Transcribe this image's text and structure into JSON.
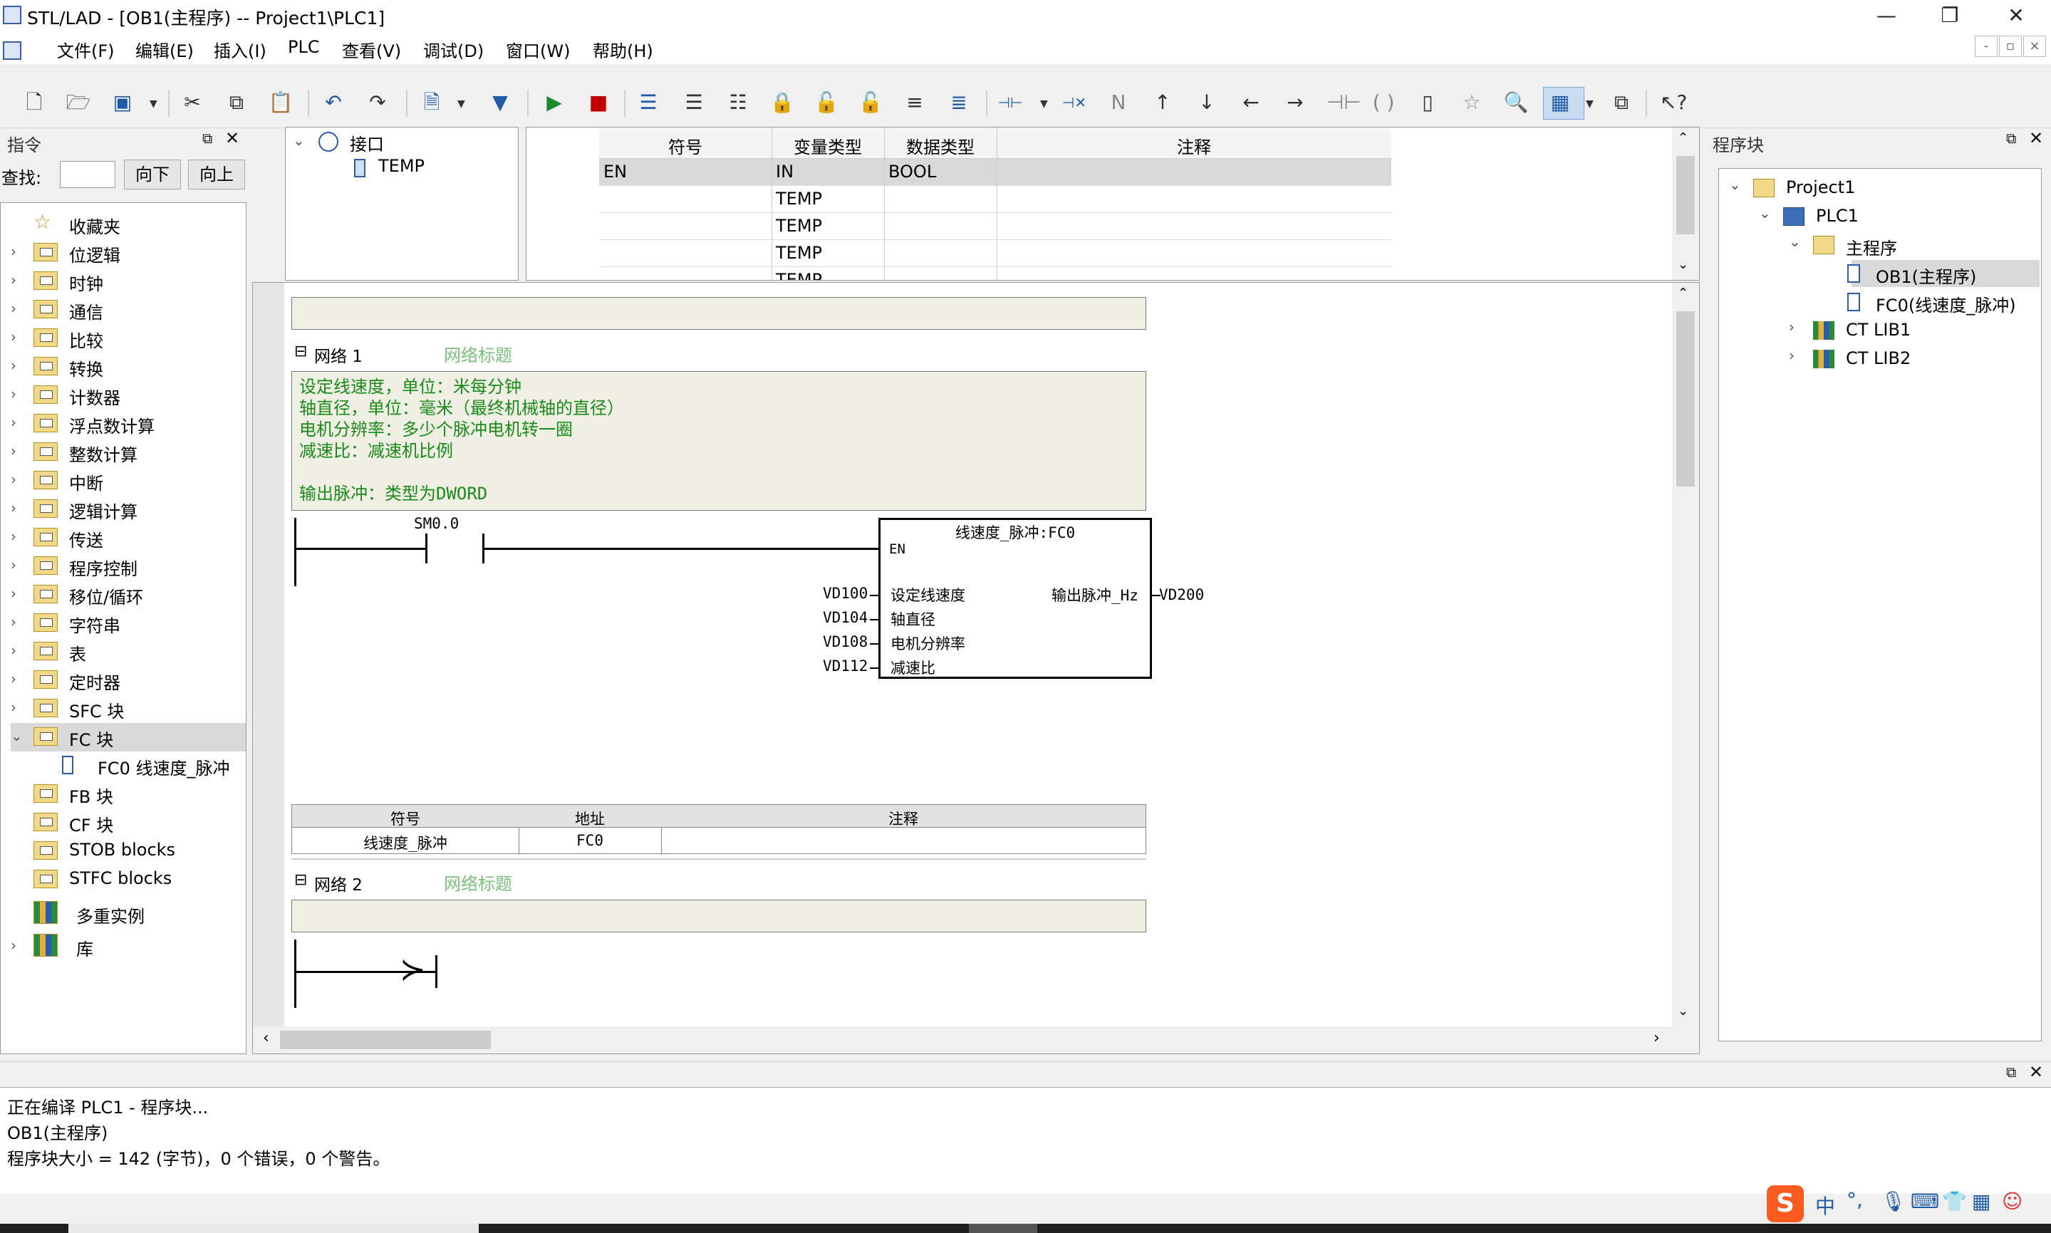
{
  "window": {
    "title": "STL/LAD - [OB1(主程序) -- Project1\\PLC1]",
    "min": "—",
    "restore": "❐",
    "close": "✕"
  },
  "menu": {
    "items": [
      "文件(F)",
      "编辑(E)",
      "插入(I)",
      "PLC",
      "查看(V)",
      "调试(D)",
      "窗口(W)",
      "帮助(H)"
    ]
  },
  "toolbar": {
    "icons": [
      "new-icon",
      "open-icon",
      "save-icon",
      "cut-icon",
      "copy-icon",
      "paste-icon",
      "undo-icon",
      "redo-icon",
      "compile-icon",
      "download-icon",
      "run-icon",
      "stop-icon",
      "insert-network-icon",
      "delete-network-icon",
      "network-icon",
      "lock-icon",
      "unlock-icon",
      "unlock-blue-icon",
      "comment-icon",
      "comment-toggle-icon",
      "contact-insert-icon",
      "contact-delete-icon",
      "negate-icon",
      "line-up-icon",
      "line-down-icon",
      "line-left-icon",
      "line-right-icon",
      "contact-icon",
      "coil-icon",
      "box-icon",
      "favorite-icon",
      "zoom-icon",
      "grid-view-icon",
      "window-icon",
      "help-icon"
    ]
  },
  "instructions": {
    "title": "指令",
    "find_label": "查找:",
    "find_value": "",
    "down_button": "向下",
    "up_button": "向上",
    "items": [
      {
        "label": "收藏夹",
        "expand": ""
      },
      {
        "label": "位逻辑",
        "expand": "›"
      },
      {
        "label": "时钟",
        "expand": "›"
      },
      {
        "label": "通信",
        "expand": "›"
      },
      {
        "label": "比较",
        "expand": "›"
      },
      {
        "label": "转换",
        "expand": "›"
      },
      {
        "label": "计数器",
        "expand": "›"
      },
      {
        "label": "浮点数计算",
        "expand": "›"
      },
      {
        "label": "整数计算",
        "expand": "›"
      },
      {
        "label": "中断",
        "expand": "›"
      },
      {
        "label": "逻辑计算",
        "expand": "›"
      },
      {
        "label": "传送",
        "expand": "›"
      },
      {
        "label": "程序控制",
        "expand": "›"
      },
      {
        "label": "移位/循环",
        "expand": "›"
      },
      {
        "label": "字符串",
        "expand": "›"
      },
      {
        "label": "表",
        "expand": "›"
      },
      {
        "label": "定时器",
        "expand": "›"
      },
      {
        "label": "SFC 块",
        "expand": "›"
      },
      {
        "label": "FC 块",
        "expand": "⌄"
      },
      {
        "label": "FC0  线速度_脉冲",
        "expand": ""
      },
      {
        "label": "FB 块",
        "expand": ""
      },
      {
        "label": "CF 块",
        "expand": ""
      },
      {
        "label": "STOB blocks",
        "expand": ""
      },
      {
        "label": "STFC blocks",
        "expand": ""
      },
      {
        "label": "多重实例",
        "expand": ""
      },
      {
        "label": "库",
        "expand": "›"
      }
    ]
  },
  "interface": {
    "root": "接口",
    "child": "TEMP",
    "headers": [
      "符号",
      "变量类型",
      "数据类型",
      "注释"
    ],
    "rows": [
      [
        "EN",
        "IN",
        "BOOL",
        ""
      ],
      [
        "",
        "TEMP",
        "",
        ""
      ],
      [
        "",
        "TEMP",
        "",
        ""
      ],
      [
        "",
        "TEMP",
        "",
        ""
      ],
      [
        "",
        "TEMP",
        "",
        ""
      ]
    ]
  },
  "editor": {
    "network1": {
      "label": "网络 1",
      "title_placeholder": "网络标题",
      "comment": [
        "设定线速度，单位：米每分钟",
        "轴直径，单位：毫米（最终机械轴的直径）",
        "电机分辨率：多少个脉冲电机转一圈",
        "减速比：减速机比例",
        "",
        "输出脉冲：类型为DWORD"
      ],
      "contact": "SM0.0",
      "box_title": "线速度_脉冲:FC0",
      "box_en": "EN",
      "inputs": [
        {
          "addr": "VD100",
          "pin": "设定线速度"
        },
        {
          "addr": "VD104",
          "pin": "轴直径"
        },
        {
          "addr": "VD108",
          "pin": "电机分辨率"
        },
        {
          "addr": "VD112",
          "pin": "减速比"
        }
      ],
      "output": {
        "pin": "输出脉冲_Hz",
        "addr": "VD200"
      },
      "symbol_table": {
        "headers": [
          "符号",
          "地址",
          "注释"
        ],
        "row": [
          "线速度_脉冲",
          "FC0",
          ""
        ]
      }
    },
    "network2": {
      "label": "网络 2",
      "title_placeholder": "网络标题"
    }
  },
  "blocks": {
    "title": "程序块",
    "tree": [
      {
        "label": "Project1",
        "expand": "⌄",
        "level": 0
      },
      {
        "label": "PLC1",
        "expand": "⌄",
        "level": 1
      },
      {
        "label": "主程序",
        "expand": "⌄",
        "level": 2
      },
      {
        "label": "OB1(主程序)",
        "expand": "",
        "level": 3,
        "selected": true
      },
      {
        "label": "FC0(线速度_脉冲)",
        "expand": "",
        "level": 3
      },
      {
        "label": "CT LIB1",
        "expand": "›",
        "level": 2
      },
      {
        "label": "CT LIB2",
        "expand": "›",
        "level": 2
      }
    ]
  },
  "output": {
    "lines": [
      "正在编译 PLC1 - 程序块...",
      "OB1(主程序)",
      "程序块大小 = 142 (字节)，0 个错误，0 个警告。"
    ]
  },
  "tray": {
    "ime_mode": "中",
    "punct": "°,"
  }
}
